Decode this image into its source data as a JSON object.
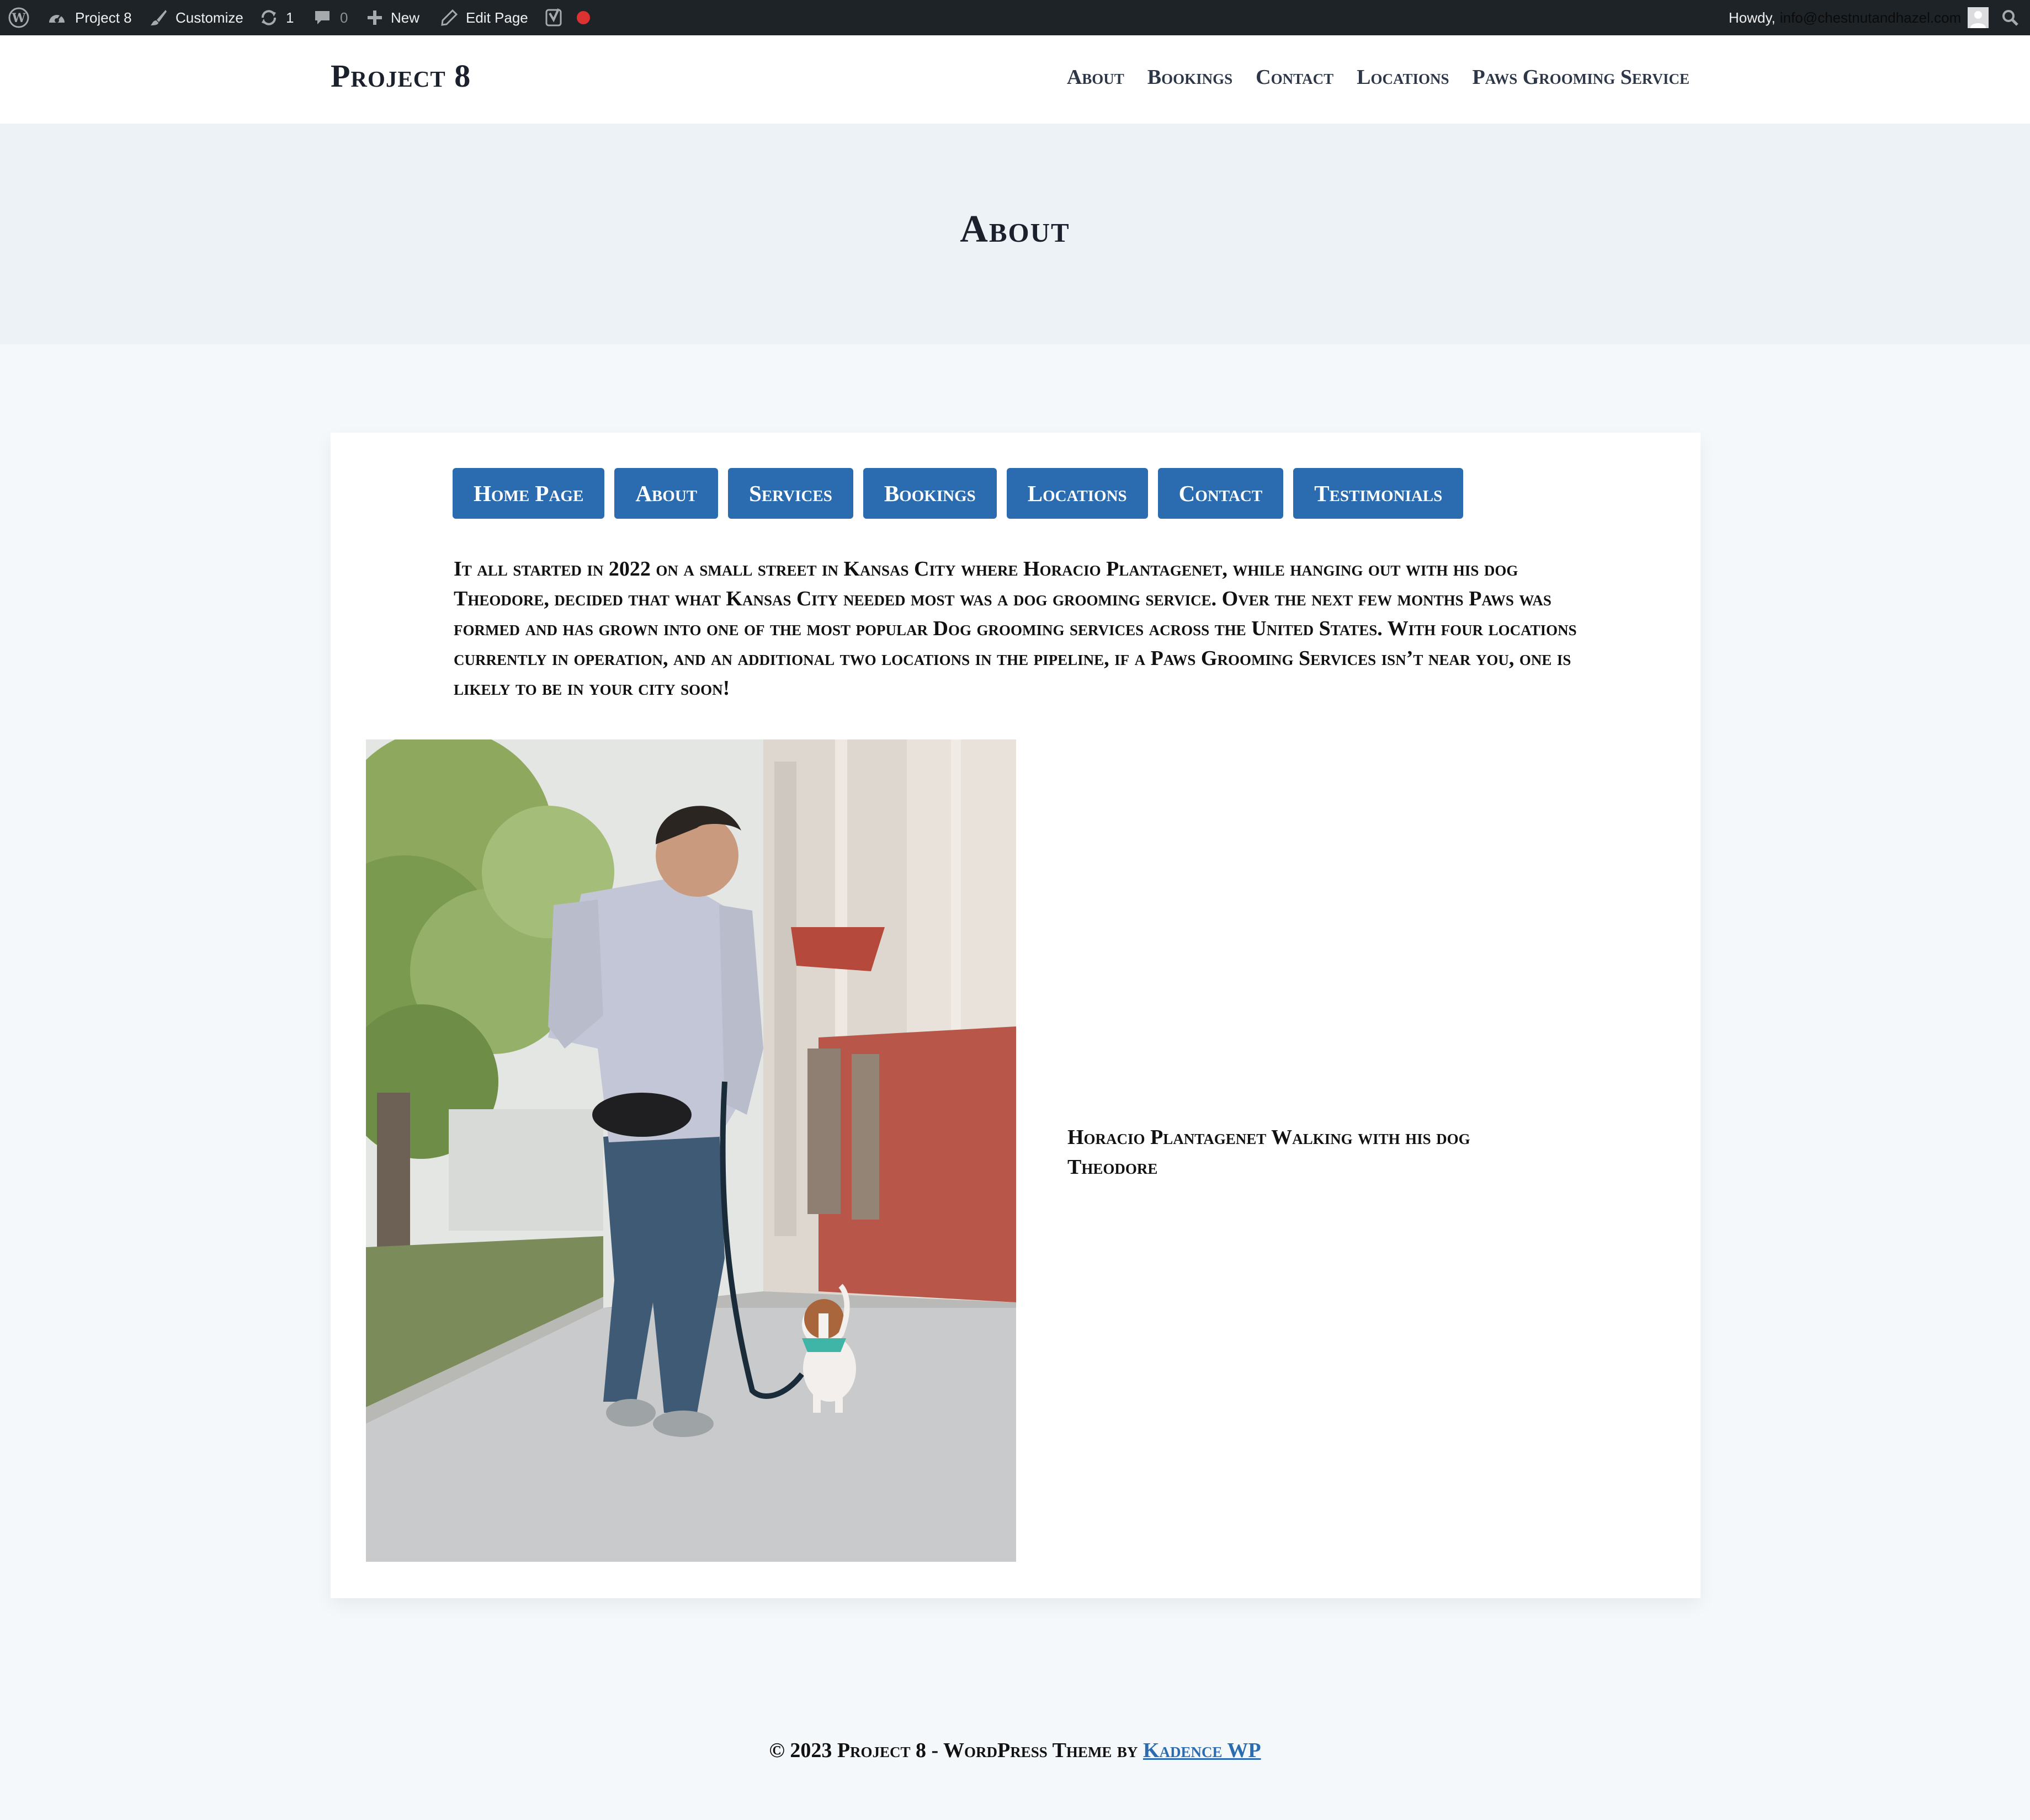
{
  "admin_bar": {
    "site_name": "Project 8",
    "customize": "Customize",
    "updates_count": "1",
    "comments_count": "0",
    "new": "New",
    "edit_page": "Edit Page",
    "howdy": "Howdy,",
    "user_email": "info@chestnutandhazel.com"
  },
  "header": {
    "site_title": "Project 8",
    "nav": [
      "About",
      "Bookings",
      "Contact",
      "Locations",
      "Paws Grooming Service"
    ]
  },
  "page": {
    "title": "About"
  },
  "content": {
    "buttons": [
      "Home Page",
      "About",
      "Services",
      "Bookings",
      "Locations",
      "Contact",
      "Testimonials"
    ],
    "intro": "It all started in 2022 on a small street in Kansas City where Horacio Plantagenet, while hanging out with his dog Theodore, decided that what Kansas City needed most was a dog grooming service. Over the next few months Paws was formed and has grown into one of the most popular Dog grooming services across the United States. With four locations currently in operation, and an additional two locations in the pipeline, if a Paws Grooming Services isn’t near you, one is likely to be in your city soon!",
    "caption": "Horacio Plantagenet Walking with his dog Theodore"
  },
  "footer": {
    "text": "© 2023 Project 8 - WordPress Theme by",
    "link_text": "Kadence WP"
  },
  "colors": {
    "admin_bar_bg": "#1d2327",
    "button_bg": "#2b6cb0",
    "title_band_bg": "#edf2f7",
    "page_bg": "#f5f8fa",
    "link": "#2b6cb0"
  },
  "icons": [
    "wordpress-logo-icon",
    "dashboard-icon",
    "brush-icon",
    "updates-icon",
    "comment-icon",
    "plus-icon",
    "pencil-icon",
    "yoast-icon",
    "status-dot-icon",
    "avatar-icon",
    "search-icon"
  ]
}
